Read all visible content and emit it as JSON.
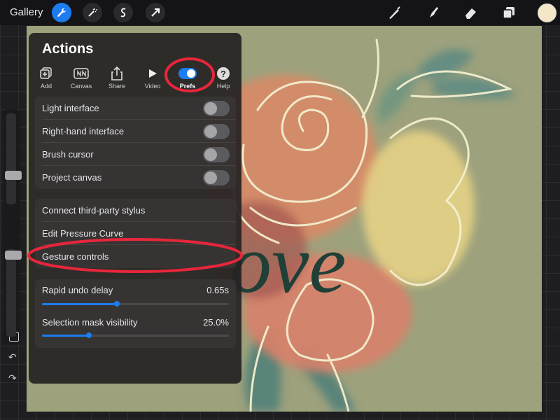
{
  "topbar": {
    "gallery_label": "Gallery",
    "tools": [
      "wrench-icon",
      "magic-wand-icon",
      "selection-icon",
      "transform-arrow-icon"
    ],
    "right_tools": [
      "brush-icon",
      "smudge-icon",
      "eraser-icon",
      "layers-icon"
    ],
    "current_color": "#f5e6c8"
  },
  "canvas": {
    "background": "#9da17c",
    "lettering": "ove"
  },
  "sidebar": {
    "size_level": 0.72,
    "opacity_level": 0.3
  },
  "panel": {
    "title": "Actions",
    "tabs": [
      {
        "label": "Add",
        "icon": "add-icon"
      },
      {
        "label": "Canvas",
        "icon": "canvas-icon"
      },
      {
        "label": "Share",
        "icon": "share-icon"
      },
      {
        "label": "Video",
        "icon": "video-icon"
      },
      {
        "label": "Prefs",
        "icon": "prefs-toggle-icon",
        "active": true
      },
      {
        "label": "Help",
        "icon": "help-icon"
      }
    ],
    "toggles": [
      {
        "label": "Light interface",
        "on": false
      },
      {
        "label": "Right-hand interface",
        "on": false
      },
      {
        "label": "Brush cursor",
        "on": false
      },
      {
        "label": "Project canvas",
        "on": false
      }
    ],
    "links": [
      "Connect third-party stylus",
      "Edit Pressure Curve",
      "Gesture controls"
    ],
    "sliders": [
      {
        "label": "Rapid undo delay",
        "value": "0.65s",
        "fraction": 0.4
      },
      {
        "label": "Selection mask visibility",
        "value": "25.0%",
        "fraction": 0.25
      }
    ]
  },
  "colors": {
    "accent": "#1c7cf0",
    "highlight": "#e8263b"
  }
}
